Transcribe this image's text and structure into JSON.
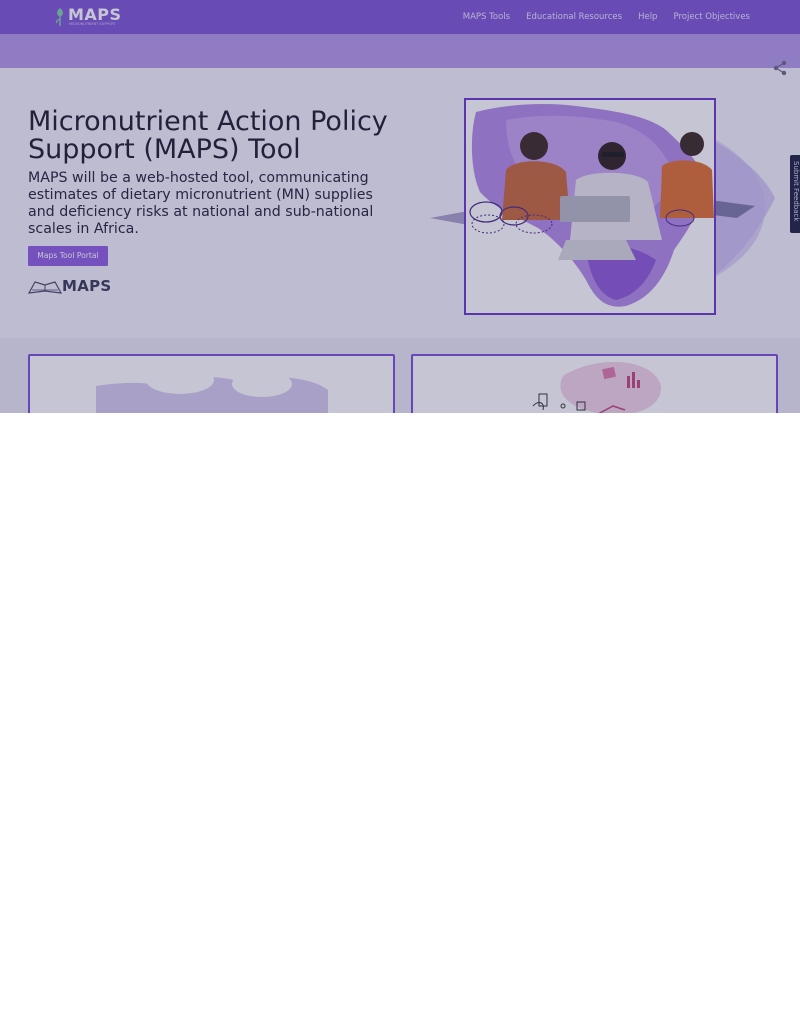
{
  "header": {
    "logo_text": "MAPS",
    "logo_tagline": "MICRONUTRIENT SUPPORT",
    "nav": [
      {
        "label": "MAPS Tools"
      },
      {
        "label": "Educational Resources"
      },
      {
        "label": "Help"
      },
      {
        "label": "Project Objectives"
      }
    ]
  },
  "hero": {
    "title": "Micronutrient Action Policy Support (MAPS) Tool",
    "description": "MAPS will be a web-hosted tool, communicating estimates of dietary micronutrient (MN) supplies and deficiency risks at national and sub-national scales in Africa.",
    "portal_button": "Maps Tool Portal",
    "small_logo_text": "MAPS"
  },
  "feedback": {
    "label": "Submit Feedback"
  },
  "colors": {
    "primary": "#7f57d6",
    "button": "#8f5fe0",
    "frame": "#6b38c9",
    "feedback_tab": "#1f2142"
  },
  "icons": [
    "maps-logo-icon",
    "share-icon",
    "hero-illustration",
    "card-map-illustration",
    "card-data-illustration"
  ]
}
